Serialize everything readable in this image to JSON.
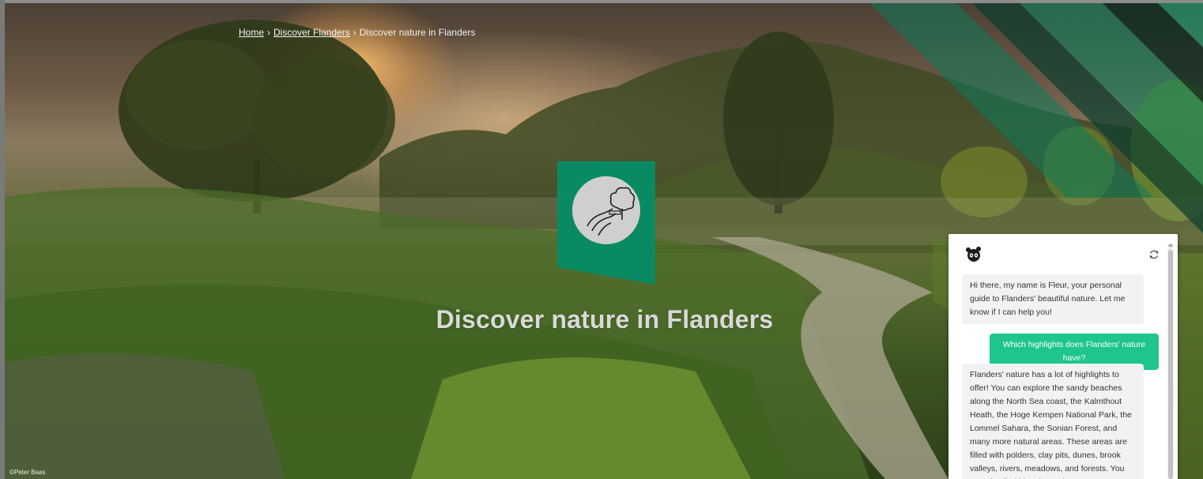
{
  "breadcrumb": {
    "home": "Home",
    "discover": "Discover Flanders",
    "current": "Discover nature in Flanders",
    "separator": "›"
  },
  "hero": {
    "title": "Discover nature in Flanders",
    "photo_credit": "©Peter Baas",
    "badge_icon": "tree-path-icon",
    "accent_color": "#0a8a62"
  },
  "chat": {
    "avatar_icon": "panda-avatar-icon",
    "refresh_icon": "refresh-icon",
    "messages": [
      {
        "role": "bot",
        "text": "Hi there, my name is Fleur, your personal guide to Flanders' beautiful nature. Let me know if I can help you!"
      },
      {
        "role": "user",
        "text": "Which highlights does Flanders' nature have?"
      },
      {
        "role": "bot",
        "text": "Flanders' nature has a lot of highlights to offer! You can explore the sandy beaches along the North Sea coast, the Kalmthout Heath, the Hoge Kempen National Park, the Lommel Sahara, the Sonian Forest, and many more natural areas. These areas are filled with polders, clay pits, dunes, brook valleys, rivers, meadows, and forests. You can also find historic castles"
      }
    ],
    "user_bubble_color": "#1ec58d"
  }
}
